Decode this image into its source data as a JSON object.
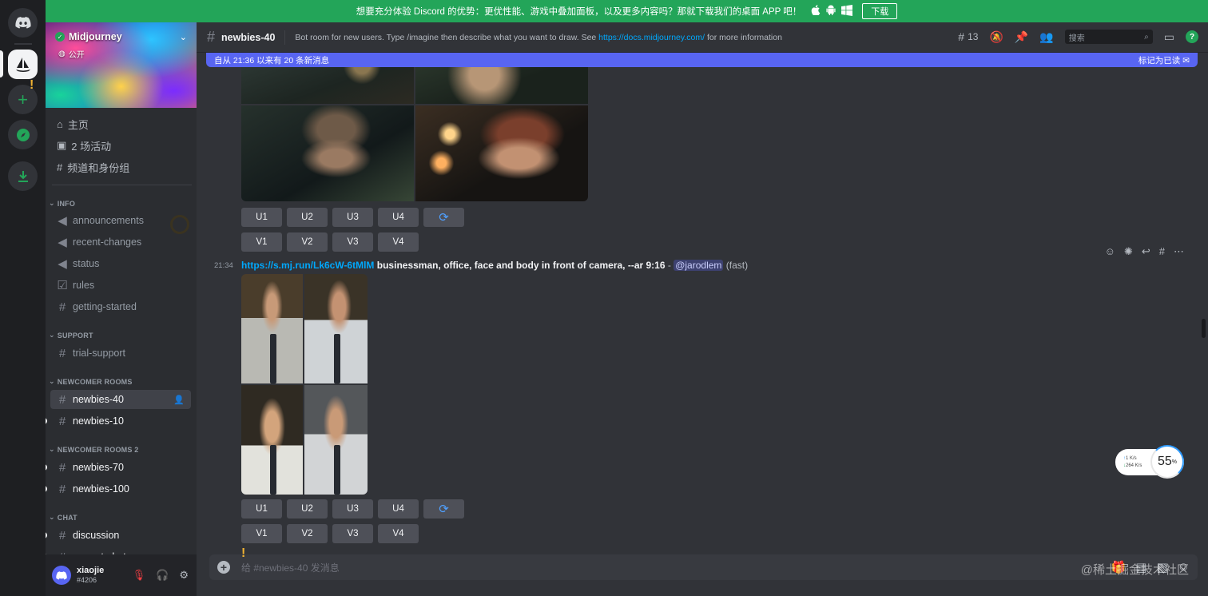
{
  "banner": {
    "text": "想要充分体验 Discord 的优势：更优性能、游戏中叠加面板，以及更多内容吗？那就下载我们的桌面 APP 吧！",
    "download_label": "下载",
    "bg_color": "#23a559"
  },
  "server": {
    "name": "Midjourney",
    "visibility": "公开"
  },
  "nav": {
    "home": "主页",
    "events": "2 场活动",
    "channels_roles": "频道和身份组"
  },
  "categories": {
    "info": "INFO",
    "support": "SUPPORT",
    "newcomer": "NEWCOMER ROOMS",
    "newcomer2": "NEWCOMER ROOMS 2",
    "chat": "CHAT"
  },
  "channels": {
    "announcements": "announcements",
    "recent_changes": "recent-changes",
    "status": "status",
    "rules": "rules",
    "getting_started": "getting-started",
    "trial_support": "trial-support",
    "newbies_40": "newbies-40",
    "newbies_10": "newbies-10",
    "newbies_70": "newbies-70",
    "newbies_100": "newbies-100",
    "discussion": "discussion",
    "prompt_chat": "prompt-chat"
  },
  "user": {
    "name": "xiaojie",
    "tag": "#4206"
  },
  "header": {
    "channel": "newbies-40",
    "topic_prefix": "Bot room for new users. Type /imagine then describe what you want to draw. See ",
    "topic_link": "https://docs.midjourney.com/",
    "topic_suffix": " for more information",
    "threads_count": "13",
    "search_placeholder": "搜索"
  },
  "new_messages": {
    "text": "自从 21:36 以来有 20 条新消息",
    "mark_read": "标记为已读",
    "color": "#5865f2"
  },
  "buttons": {
    "u1": "U1",
    "u2": "U2",
    "u3": "U3",
    "u4": "U4",
    "v1": "V1",
    "v2": "V2",
    "v3": "V3",
    "v4": "V4"
  },
  "message": {
    "time": "21:34",
    "link": "https://s.mj.run/Lk6cW-6tMlM",
    "prompt": " businessman, office, face and body in front of camera, --ar 9:16",
    "sep": " - ",
    "mention": "@jarodlem",
    "mode": " (fast)"
  },
  "composer": {
    "placeholder": "给 #newbies-40 发消息"
  },
  "speed_widget": {
    "up": "1  K/s",
    "down": "264 K/s",
    "percent": "55",
    "percent_sign": "%"
  },
  "watermark": "@稀土掘金技术社区"
}
